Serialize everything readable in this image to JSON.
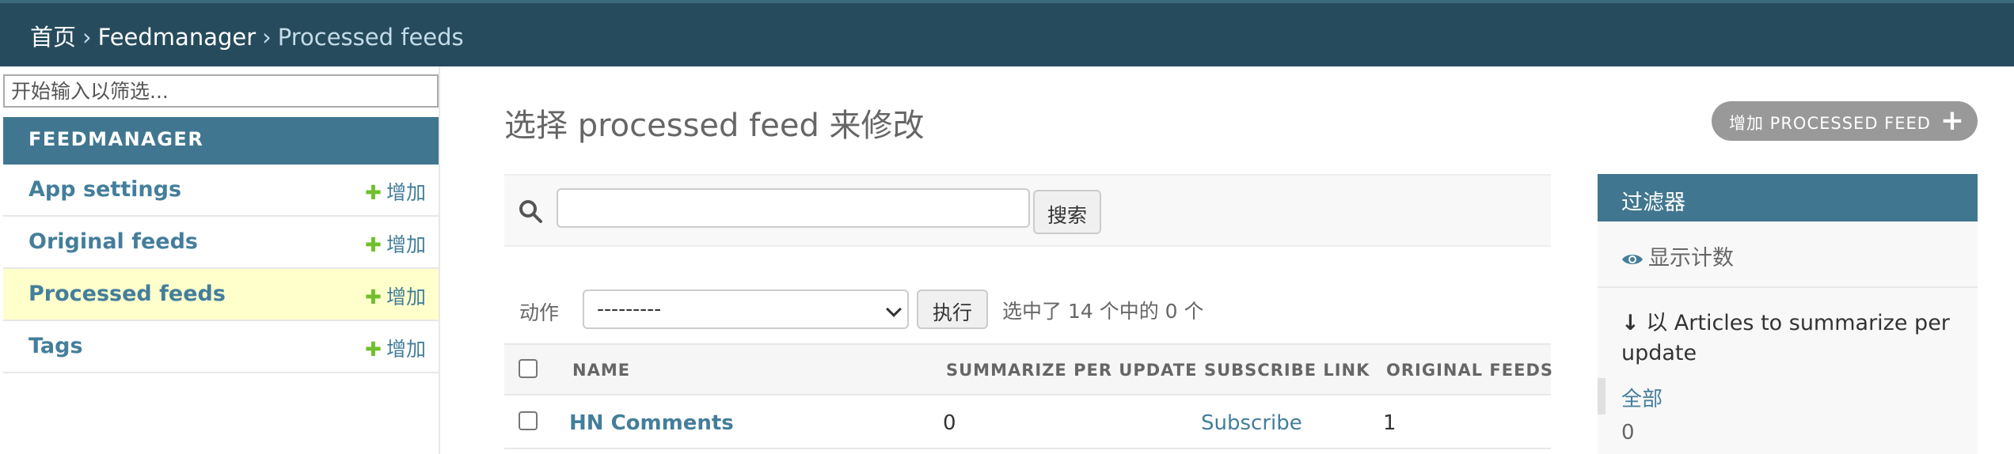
{
  "header": {
    "breadcrumb": {
      "home": "首页",
      "app": "Feedmanager",
      "current": "Processed feeds",
      "separator": "›"
    }
  },
  "sidebar": {
    "filter_placeholder": "开始输入以筛选...",
    "module_caption": "FEEDMANAGER",
    "add_label": "增加",
    "items": [
      {
        "label": "App settings"
      },
      {
        "label": "Original feeds"
      },
      {
        "label": "Processed feeds",
        "current": true
      },
      {
        "label": "Tags"
      }
    ]
  },
  "main": {
    "title": "选择 processed feed 来修改",
    "add_button": "增加 PROCESSED FEED",
    "search": {
      "value": "",
      "button": "搜索"
    },
    "actions": {
      "label": "动作",
      "selected_option": "---------",
      "go_button": "执行",
      "selected_count": "选中了 14 个中的 0 个"
    },
    "table": {
      "columns": [
        "NAME",
        "SUMMARIZE PER UPDATE",
        "SUBSCRIBE LINK",
        "ORIGINAL FEEDS"
      ],
      "rows": [
        {
          "name": "HN Comments",
          "summarize_per_update": "0",
          "subscribe_link": "Subscribe",
          "original_feeds": "1"
        }
      ]
    }
  },
  "filter": {
    "title": "过滤器",
    "show_counts": "显示计数",
    "by_heading": "以 Articles to summarize per update",
    "options": [
      {
        "label": "全部",
        "count": "0"
      }
    ]
  },
  "colors": {
    "header_bg": "#264b5d",
    "module_bg": "#417690",
    "link": "#447e9b",
    "add_green": "#70bf2b",
    "current_row": "#ffffcc"
  }
}
